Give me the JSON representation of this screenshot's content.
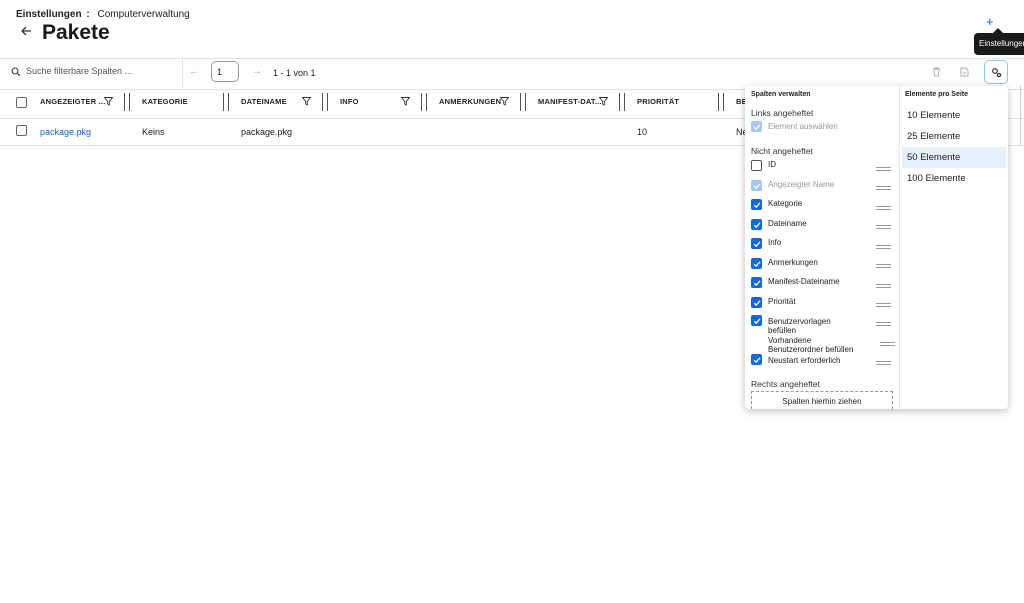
{
  "breadcrumb": {
    "settings": "Einstellungen",
    "sep": ":",
    "current": "Computerverwaltung"
  },
  "page": {
    "back_icon": "arrow-left-icon",
    "title": "Pakete",
    "add_label": "+"
  },
  "tooltip": "Einstellungen",
  "toolbar": {
    "search_placeholder": "Suche filterbare Spalten ...",
    "page_value": "1",
    "page_range": "1 - 1 von 1",
    "prev": "←",
    "next": "→"
  },
  "columns": [
    "ANGEZEIGTER ...",
    "KATEGORIE",
    "DATEINAME",
    "INFO",
    "ANMERKUNGEN",
    "MANIFEST-DAT...",
    "PRIORITÄT",
    "BE"
  ],
  "rows": [
    {
      "name": "package.pkg",
      "category": "Keins",
      "filename": "package.pkg",
      "info": "",
      "notes": "",
      "manifest": "",
      "priority": "10",
      "extra": "Ne"
    }
  ],
  "column_panel": {
    "title": "Spalten verwalten",
    "pinned_left_label": "Links angeheftet",
    "pinned_left_item": "Element auswählen",
    "unpinned_label": "Nicht angeheftet",
    "items": [
      {
        "label": "ID",
        "state": "off"
      },
      {
        "label": "Angezeigter Name",
        "state": "disabled"
      },
      {
        "label": "Kategorie",
        "state": "on"
      },
      {
        "label": "Dateiname",
        "state": "on"
      },
      {
        "label": "Info",
        "state": "on"
      },
      {
        "label": "Anmerkungen",
        "state": "on"
      },
      {
        "label": "Manifest-Dateiname",
        "state": "on"
      },
      {
        "label": "Priorität",
        "state": "on"
      },
      {
        "label": "Benutzervorlagen befüllen",
        "state": "on"
      },
      {
        "label": "Vorhandene Benutzerordner befüllen",
        "state": "on"
      },
      {
        "label": "Neustart erforderlich",
        "state": "on"
      }
    ],
    "pinned_right_label": "Rechts angeheftet",
    "dropzone": "Spalten hierhin ziehen"
  },
  "page_size": {
    "title": "Elemente pro Seite",
    "options": [
      "10 Elemente",
      "25 Elemente",
      "50 Elemente",
      "100 Elemente"
    ],
    "selected": "50 Elemente"
  },
  "colors": {
    "accent": "#1967d2",
    "link": "#1565c0",
    "selected_bg": "#e4f0fb"
  }
}
